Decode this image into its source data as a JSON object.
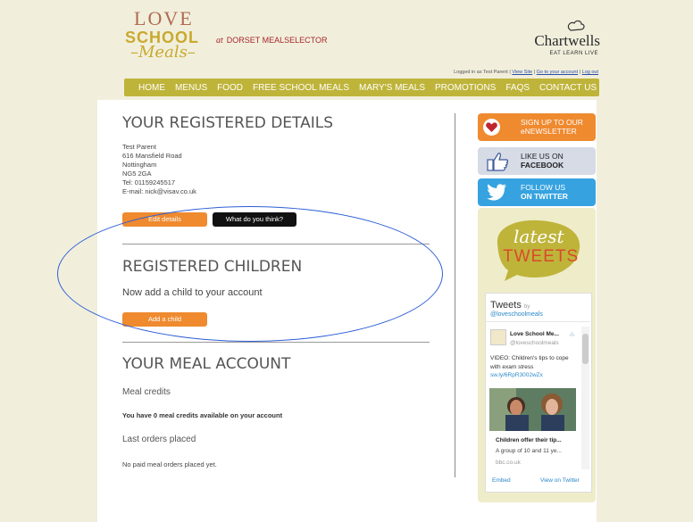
{
  "brand": {
    "logo_love": "LOVE",
    "logo_school": "SCHOOL",
    "logo_meals": "Meals",
    "at": "at",
    "region": "DORSET MEALSELECTOR",
    "partner_name": "Chartwells",
    "partner_tagline": "EAT LEARN LIVE"
  },
  "login": {
    "prefix": "Logged in as Test Parent |",
    "view_site": "View Site",
    "sep1": "|",
    "account": "Go to your account",
    "sep2": "|",
    "logout": "Log out"
  },
  "nav": {
    "items": [
      "HOME",
      "MENUS",
      "FOOD",
      "FREE SCHOOL MEALS",
      "MARY'S MEALS",
      "PROMOTIONS",
      "FAQS",
      "CONTACT US"
    ]
  },
  "details": {
    "heading": "YOUR REGISTERED DETAILS",
    "name": "Test Parent",
    "street": "616 Mansfield Road",
    "city": "Nottingham",
    "postcode": "NG5 2GA",
    "tel": "Tel: 01159245517",
    "email": "E-mail: nick@visav.co.uk",
    "edit_button": "Edit details",
    "feedback_button": "What do you think?"
  },
  "children": {
    "heading": "REGISTERED CHILDREN",
    "prompt": "Now add a child to your account",
    "add_button": "Add a child"
  },
  "meal_account": {
    "heading": "YOUR MEAL ACCOUNT",
    "credits_label": "Meal credits",
    "credits_text": "You have 0 meal credits available on your account",
    "orders_label": "Last orders placed",
    "orders_text": "No paid meal orders placed yet."
  },
  "sidebar": {
    "newsletter_l1": "SIGN UP TO OUR",
    "newsletter_l2": "eNEWSLETTER",
    "facebook_l1": "LIKE US ON",
    "facebook_l2": "FACEBOOK",
    "twitter_l1": "FOLLOW US",
    "twitter_l2": "ON TWITTER",
    "latest": "latest",
    "tweets": "TWEETS"
  },
  "twitter_widget": {
    "title": "Tweets",
    "by": "by",
    "handle": "@loveschoolmeals",
    "tweet_name": "Love School Me...",
    "tweet_handle": "@loveschoolmeals",
    "tweet_text": "VIDEO: Children's tips to cope with exam stress",
    "tweet_link": "sw.ly/6RpR3002wZx",
    "card_title": "Children offer their tip...",
    "card_desc": "A group of 10 and 11 ye...",
    "card_source": "bbc.co.uk",
    "embed": "Embed",
    "view_on_twitter": "View on Twitter"
  },
  "colors": {
    "nav_bg": "#bfb43a",
    "orange": "#ef8a2f",
    "facebook": "#3b5998",
    "twitter": "#36a3e0",
    "highlight_ellipse": "#2e5fd6"
  }
}
